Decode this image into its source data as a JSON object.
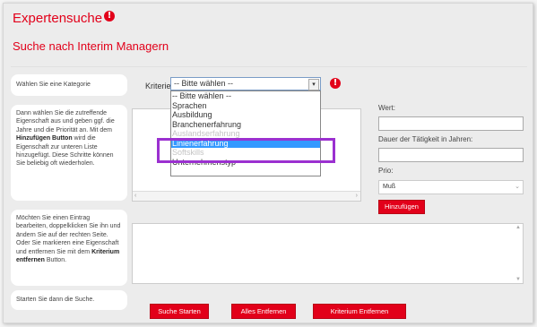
{
  "header": {
    "title": "Expertensuche",
    "info_icon": "!",
    "subtitle": "Suche nach Interim Managern"
  },
  "sidebar": {
    "step1": "Wählen Sie eine Kategorie",
    "step2": {
      "a": "Dann wählen Sie die zutreffende Eigenschaft aus und geben ggf. die Jahre und die Priorität an. Mit dem ",
      "b": "Hinzufügen Button",
      "c": " wird die Eigenschaft zur unteren Liste hinzugefügt. Diese Schritte können Sie beliebig oft wiederholen."
    },
    "step3": {
      "a": "Möchten Sie einen Eintrag bearbeiten, doppelklicken Sie ihn und ändern Sie auf der rechten Seite. Oder Sie markieren eine Eigenschaft und entfernen Sie mit dem ",
      "b": "Kriterium entfernen",
      "c": " Button."
    },
    "step4": "Starten Sie dann die Suche."
  },
  "criteria": {
    "label": "Kriterien:",
    "selected": "-- Bitte wählen --",
    "options": [
      "-- Bitte wählen --",
      "Sprachen",
      "Ausbildung",
      "Branchenerfahrung",
      "Auslandserfahrung",
      "Linienerfahrung",
      "Softskills",
      "Unternehmenstyp"
    ],
    "highlighted": "Linienerfahrung"
  },
  "form": {
    "wert_label": "Wert:",
    "dauer_label": "Dauer der Tätigkeit in Jahren:",
    "prio_label": "Prio:",
    "prio_value": "Muß",
    "add_button": "Hinzufügen"
  },
  "buttons": {
    "search": "Suche Starten",
    "remove_all": "Alles Entfernen",
    "remove_criterion": "Kriterium Entfernen"
  },
  "colors": {
    "accent": "#e2001a",
    "highlight_box": "#9b30d0",
    "selection": "#3399ff"
  }
}
